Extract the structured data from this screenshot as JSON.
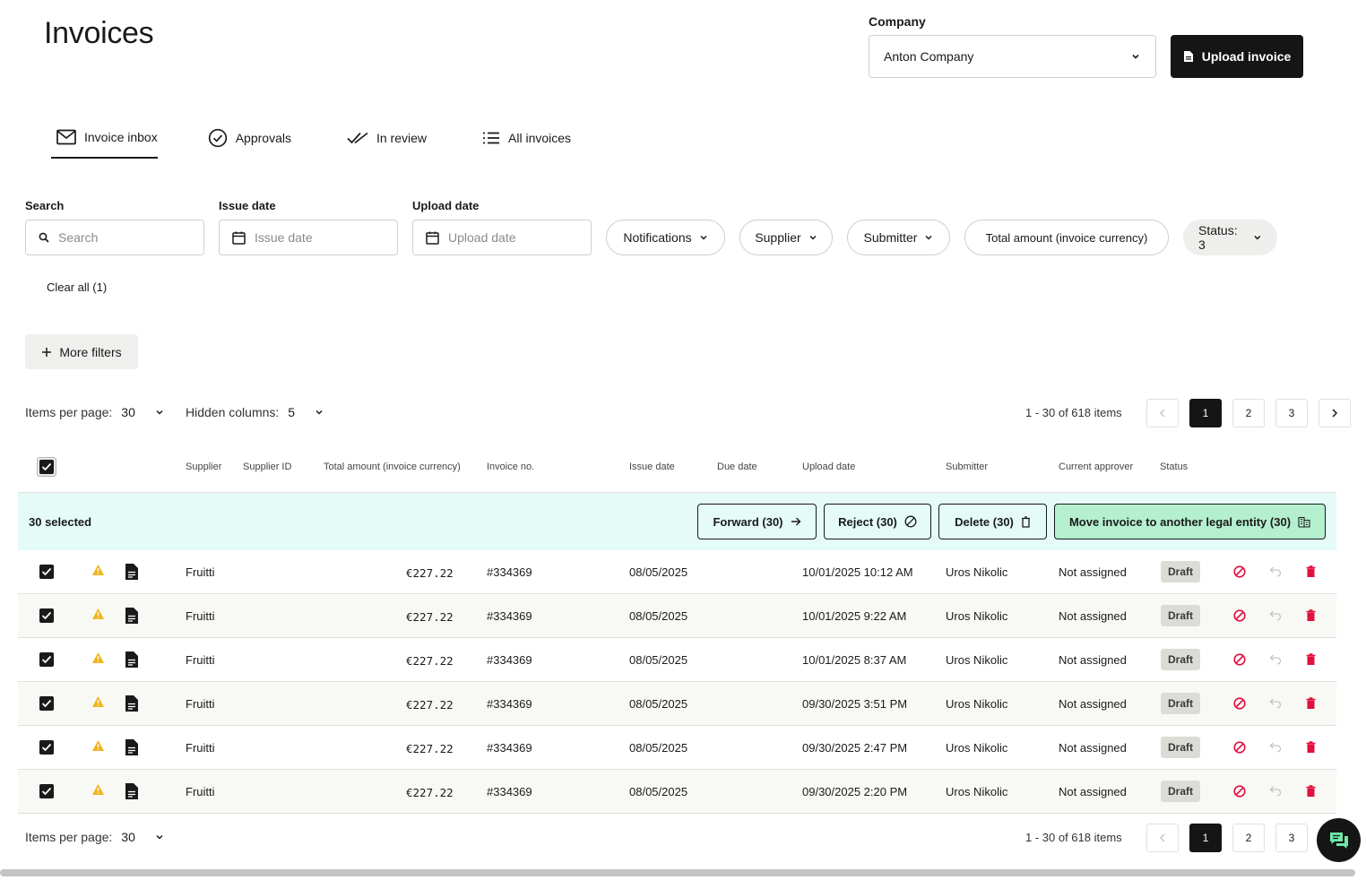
{
  "header": {
    "title": "Invoices",
    "company_label": "Company",
    "company_value": "Anton Company",
    "upload_label": "Upload invoice"
  },
  "tabs": [
    {
      "label": "Invoice inbox",
      "icon": "mail-icon",
      "active": true
    },
    {
      "label": "Approvals",
      "icon": "check-circle-icon"
    },
    {
      "label": "In review",
      "icon": "double-check-icon"
    },
    {
      "label": "All invoices",
      "icon": "list-icon"
    }
  ],
  "filters": {
    "search_label": "Search",
    "search_placeholder": "Search",
    "issue_label": "Issue date",
    "issue_placeholder": "Issue date",
    "upload_label": "Upload date",
    "upload_placeholder": "Upload date",
    "pills": [
      "Notifications",
      "Supplier",
      "Submitter",
      "Total amount (invoice currency)",
      "Status: 3"
    ],
    "clear_all": "Clear all (1)",
    "more_filters": "More filters"
  },
  "pagination": {
    "items_per_page_label": "Items per page:",
    "items_per_page": "30",
    "hidden_columns_label": "Hidden columns:",
    "hidden_columns": "5",
    "range": "1 - 30 of 618 items",
    "pages": [
      "1",
      "2",
      "3"
    ],
    "current_page": "1"
  },
  "table": {
    "columns": [
      "Supplier",
      "Supplier ID",
      "Total amount (invoice currency)",
      "Invoice no.",
      "Issue date",
      "Due date",
      "Upload date",
      "Submitter",
      "Current approver",
      "Status"
    ],
    "selection": {
      "count_label": "30 selected",
      "forward": "Forward (30)",
      "reject": "Reject (30)",
      "delete": "Delete (30)",
      "move": "Move invoice to another legal entity (30)"
    },
    "rows": [
      {
        "supplier": "Fruitti",
        "amount": "€227.22",
        "invoice_no": "#334369",
        "issue_date": "08/05/2025",
        "upload_date": "10/01/2025 10:12 AM",
        "submitter": "Uros Nikolic",
        "approver": "Not assigned",
        "status": "Draft"
      },
      {
        "supplier": "Fruitti",
        "amount": "€227.22",
        "invoice_no": "#334369",
        "issue_date": "08/05/2025",
        "upload_date": "10/01/2025 9:22 AM",
        "submitter": "Uros Nikolic",
        "approver": "Not assigned",
        "status": "Draft"
      },
      {
        "supplier": "Fruitti",
        "amount": "€227.22",
        "invoice_no": "#334369",
        "issue_date": "08/05/2025",
        "upload_date": "10/01/2025 8:37 AM",
        "submitter": "Uros Nikolic",
        "approver": "Not assigned",
        "status": "Draft"
      },
      {
        "supplier": "Fruitti",
        "amount": "€227.22",
        "invoice_no": "#334369",
        "issue_date": "08/05/2025",
        "upload_date": "09/30/2025 3:51 PM",
        "submitter": "Uros Nikolic",
        "approver": "Not assigned",
        "status": "Draft"
      },
      {
        "supplier": "Fruitti",
        "amount": "€227.22",
        "invoice_no": "#334369",
        "issue_date": "08/05/2025",
        "upload_date": "09/30/2025 2:47 PM",
        "submitter": "Uros Nikolic",
        "approver": "Not assigned",
        "status": "Draft"
      },
      {
        "supplier": "Fruitti",
        "amount": "€227.22",
        "invoice_no": "#334369",
        "issue_date": "08/05/2025",
        "upload_date": "09/30/2025 2:20 PM",
        "submitter": "Uros Nikolic",
        "approver": "Not assigned",
        "status": "Draft"
      }
    ]
  },
  "colors": {
    "primary": "#151515",
    "selection_bar": "#e4fbf8",
    "move_button": "#b4efd0",
    "warning": "#f2b418",
    "danger": "#e0103f",
    "draft_badge": "#dcdcd6"
  }
}
